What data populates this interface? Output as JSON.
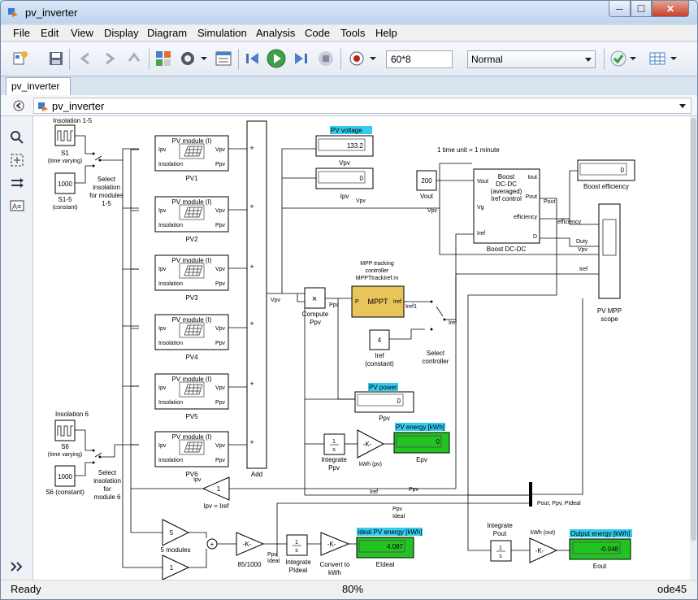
{
  "window": {
    "title": "pv_inverter",
    "buttons": {
      "minimize": "─",
      "maximize": "☐",
      "close": "✕"
    }
  },
  "menu": [
    "File",
    "Edit",
    "View",
    "Display",
    "Diagram",
    "Simulation",
    "Analysis",
    "Code",
    "Tools",
    "Help"
  ],
  "toolbar": {
    "stop_time": "60*8",
    "sim_mode": "Normal"
  },
  "tab": {
    "label": "pv_inverter"
  },
  "explorer": {
    "path": "pv_inverter"
  },
  "status": {
    "left": "Ready",
    "zoom": "80%",
    "solver": "ode45"
  },
  "diagram": {
    "note_time": "1 time unit = 1 minute",
    "insolation_top": "Insolation 1-5",
    "s1_label": [
      "S1",
      "(time varying)"
    ],
    "const1000": "1000",
    "s15_label": [
      "S1-5",
      "(constant)"
    ],
    "select1": [
      "Select",
      "insolation",
      "for modules",
      "1-5"
    ],
    "pv_title": "PV module (I)",
    "pv_names": [
      "PV1",
      "PV2",
      "PV3",
      "PV4",
      "PV5",
      "PV6"
    ],
    "port_ipv": "Ipv",
    "port_vpv": "Vpv",
    "port_ins": "Insolation",
    "port_ppv": "Ppv",
    "add_label": "Add",
    "insolation6": "Insolation 6",
    "s6_label": [
      "S6",
      "(time varying)"
    ],
    "s6c_label": "S6 (constant)",
    "select6": [
      "Select",
      "insolation",
      "for",
      "module 6"
    ],
    "pv_voltage_tag": "PV voltage",
    "pv_voltage_value": "133.2",
    "vpv_label": "Vpv",
    "ipv_value": "0",
    "ipv_label": "Ipv",
    "vout_const": "200",
    "vout_label": "Vout",
    "boost_block": [
      "Boost",
      "DC-DC",
      "(averaged)",
      "Iref control"
    ],
    "boost_ports": {
      "vout": "Vout",
      "vg": "Vg",
      "iref": "Iref",
      "iout": "Iout",
      "pout": "Pout",
      "efficiency": "efficiency",
      "d": "D"
    },
    "boost_label": "Boost DC-DC",
    "boost_eff_value": "0",
    "boost_eff_label": "Boost efficiency",
    "scope_label": [
      "PV MPP",
      "scope"
    ],
    "mppt_caption": [
      "MPP tracking",
      "controller",
      "MPPTtrackIref.m"
    ],
    "mppt_block": "MPPT",
    "mppt_p": "P",
    "mppt_iref": "Iref",
    "compute_ppv": [
      "Compute",
      "Ppv"
    ],
    "iref_const": "4",
    "iref_const_label": [
      "Iref",
      "(constant)"
    ],
    "select_ctrl": [
      "Select",
      "controller"
    ],
    "pv_power_tag": "PV power",
    "pv_power_value": "0",
    "ppv_label": "Ppv",
    "pv_energy_tag": "PV energy [kWh]",
    "pv_energy_value": "0",
    "epv_label": "Epv",
    "integrate_ppv": [
      "Integrate",
      "Ppv"
    ],
    "gain_k": "-K-",
    "kwh_pv": "kWh (pv)",
    "ipv_iref_label": "Ipv = Iref",
    "five_modules": "5 modules",
    "gain5": "5",
    "gain1": "1",
    "gain8510": "85/1000",
    "integrate_pideal": [
      "Integrate",
      "PIdeal"
    ],
    "convert_kwh": [
      "Convert to",
      "kWh"
    ],
    "ideal_tag": "Ideal PV energy [kWh]",
    "ideal_value": "4.087",
    "eideal_label": "EIdeal",
    "integrate_pout": [
      "Integrate",
      "Pout"
    ],
    "kwh_out": "kWh (out)",
    "output_tag": "Output energy [kWh]",
    "output_value": "-0.048",
    "eout_label": "Eout",
    "mux_label": "Pout, Ppv, PIdeal",
    "int_sym": "1",
    "int_den": "s",
    "signals": {
      "vpv": "Vpv",
      "iref": "Iref",
      "iref1": "Iref1",
      "ppv": "Ppv",
      "pideal": "PIdeal",
      "ipv": "Ipv",
      "efficiency": "efficiency",
      "duty": "Duty",
      "pout": "Pout",
      "ppv_ideal": [
        "Ppv",
        "Ideal"
      ]
    }
  }
}
